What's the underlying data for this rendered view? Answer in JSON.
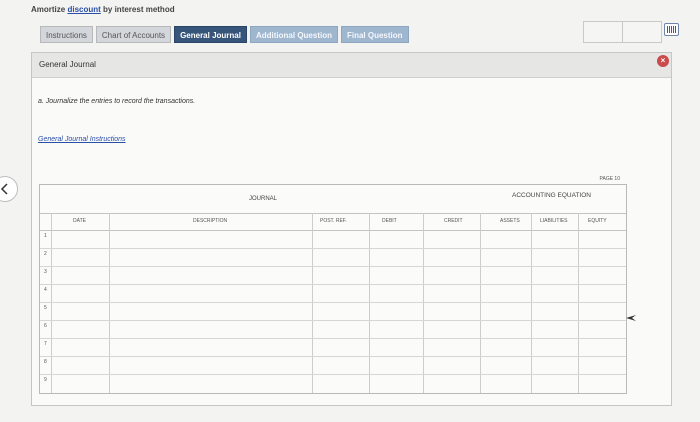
{
  "page": {
    "title_prefix": "Amortize ",
    "title_keyword": "discount",
    "title_suffix": " by interest method"
  },
  "tabs": [
    {
      "label": "Instructions"
    },
    {
      "label": "Chart of Accounts"
    },
    {
      "label": "General Journal"
    },
    {
      "label": "Additional Question"
    },
    {
      "label": "Final Question"
    }
  ],
  "panel": {
    "header": "General Journal",
    "instruction": "a. Journalize the entries to record the transactions.",
    "link": "General Journal Instructions"
  },
  "journal": {
    "page_label": "PAGE 10",
    "title": "JOURNAL",
    "equation_title": "ACCOUNTING EQUATION",
    "columns": [
      "DATE",
      "DESCRIPTION",
      "POST. REF.",
      "DEBIT",
      "CREDIT",
      "ASSETS",
      "LIABILITIES",
      "EQUITY"
    ],
    "rows": [
      "1",
      "2",
      "3",
      "4",
      "5",
      "6",
      "7",
      "8",
      "9"
    ]
  },
  "icons": {
    "close": "close-icon",
    "grid": "grid-icon",
    "nav": "chevron-left-icon",
    "cursor": "mouse-cursor-icon"
  }
}
